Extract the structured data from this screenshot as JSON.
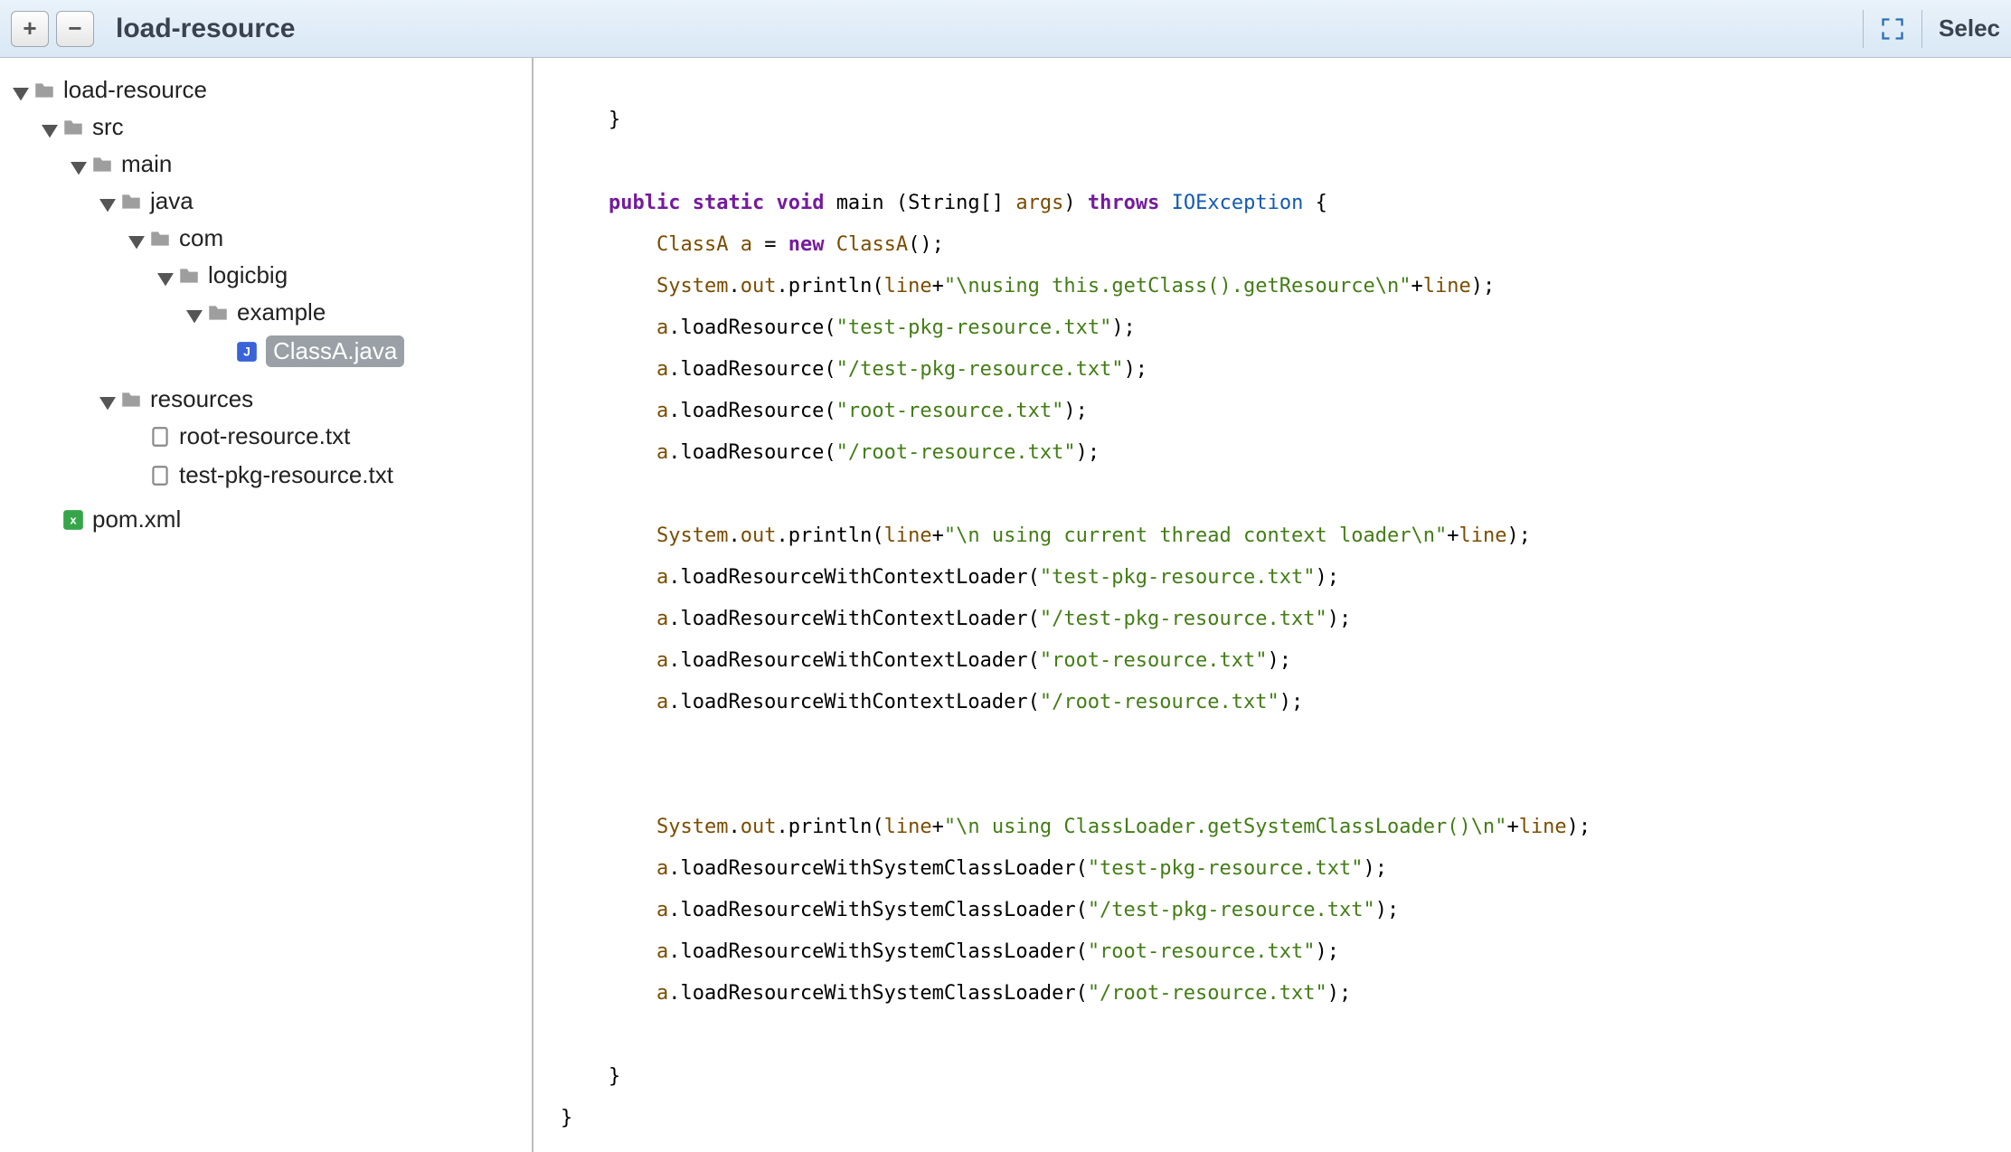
{
  "toolbar": {
    "plus": "+",
    "minus": "−",
    "title": "load-resource",
    "select": "Selec"
  },
  "tree": {
    "root": "load-resource",
    "src": "src",
    "main": "main",
    "java": "java",
    "com": "com",
    "logicbig": "logicbig",
    "example": "example",
    "classA": "ClassA.java",
    "resources": "resources",
    "rootRes": "root-resource.txt",
    "testRes": "test-pkg-resource.txt",
    "pom": "pom.xml"
  },
  "code": {
    "l0": "    }",
    "kw_public": "public",
    "kw_static": "static",
    "kw_void": "void",
    "kw_throws": "throws",
    "kw_new": "new",
    "id_main": "main",
    "id_String": "String",
    "id_args": "args",
    "id_IOException": "IOException",
    "id_ClassA": "ClassA",
    "id_a": "a",
    "id_System": "System",
    "id_out": "out",
    "id_println": "println",
    "id_line": "line",
    "m_loadResource": "loadResource",
    "m_loadCtx": "loadResourceWithContextLoader",
    "m_loadSys": "loadResourceWithSystemClassLoader",
    "s1": "\"\\nusing this.getClass().getResource\\n\"",
    "s_tpr": "\"test-pkg-resource.txt\"",
    "s_tpr2": "\"/test-pkg-resource.txt\"",
    "s_rr": "\"root-resource.txt\"",
    "s_rr2": "\"/root-resource.txt\"",
    "s2": "\"\\n using current thread context loader\\n\"",
    "s3": "\"\\n using ClassLoader.getSystemClassLoader()\\n\"",
    "close_brace1": "    }",
    "close_brace2": "}"
  }
}
